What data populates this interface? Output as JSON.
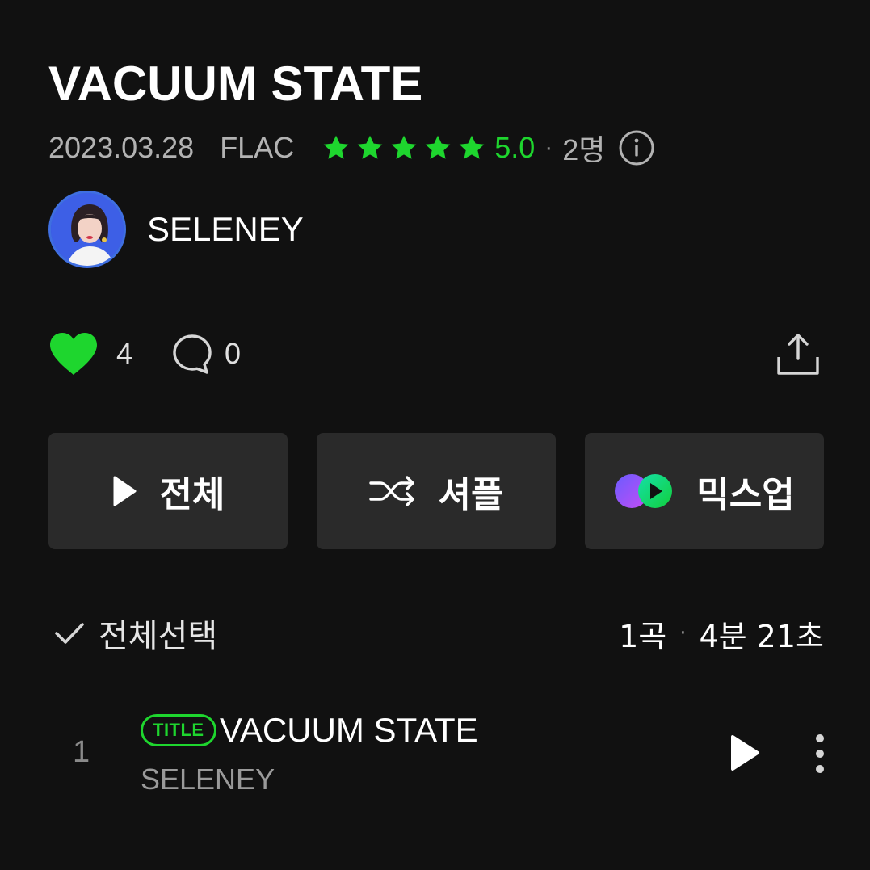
{
  "album": {
    "title": "VACUUM STATE",
    "release_date": "2023.03.28",
    "format": "FLAC",
    "rating_value": "5.0",
    "rating_stars": 5,
    "rating_count": "2명",
    "separator": "·"
  },
  "artist": {
    "name": "SELENEY"
  },
  "social": {
    "likes": "4",
    "comments": "0"
  },
  "actions": {
    "play_all": "전체",
    "shuffle": "셔플",
    "mixup": "믹스업"
  },
  "tracklist": {
    "select_all": "전체선택",
    "track_count": "1곡",
    "total_duration": "4분 21초",
    "tracks": [
      {
        "number": "1",
        "badge": "TITLE",
        "title": "VACUUM STATE",
        "artist": "SELENEY"
      }
    ]
  },
  "colors": {
    "background": "#111111",
    "accent_green": "#1ed62e",
    "button_bg": "#2a2a2a",
    "muted_text": "#b2b2b2"
  },
  "icons": {
    "rating": "star-icon",
    "info": "info-icon",
    "like": "heart-icon",
    "comment": "comment-icon",
    "share": "share-icon",
    "play": "play-icon",
    "shuffle": "shuffle-icon",
    "mixup": "mixup-icon",
    "check": "check-icon",
    "more": "more-vertical-icon"
  }
}
